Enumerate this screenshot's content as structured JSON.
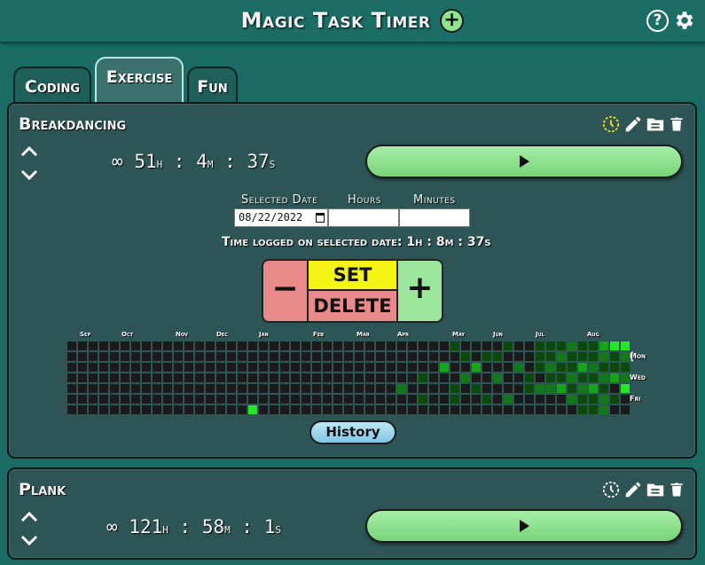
{
  "app": {
    "title": "Magic Task Timer"
  },
  "header_icons": [
    "plus-circle-icon",
    "help-icon",
    "gear-icon"
  ],
  "help_glyph": "?",
  "tabs": [
    {
      "label": "Coding",
      "active": false
    },
    {
      "label": "Exercise",
      "active": true
    },
    {
      "label": "Fun",
      "active": false
    }
  ],
  "tasks": [
    {
      "name": "Breakdancing",
      "timer": {
        "infinity": "∞",
        "hours": "51",
        "minutes": "4",
        "seconds": "37",
        "h_unit": "h",
        "m_unit": "m",
        "s_unit": "s",
        "sep": ":"
      },
      "actions": [
        "clock-icon",
        "pencil-icon",
        "folder-icon",
        "trash-icon"
      ],
      "editor": {
        "date_label": "Selected Date",
        "hours_label": "Hours",
        "minutes_label": "Minutes",
        "date_value": "08/22/2022",
        "hours_value": "",
        "minutes_value": "",
        "logged_text": "Time logged on selected date: 1h : 8m : 37s",
        "minus": "−",
        "plus": "+",
        "set": "SET",
        "delete": "DELETE"
      },
      "heatmap": {
        "months": [
          "Sep",
          "Oct",
          "Nov",
          "Dec",
          "Jan",
          "Feb",
          "Mar",
          "Apr",
          "May",
          "Jun",
          "Jul",
          "Aug"
        ],
        "days": [
          "Mon",
          "Wed",
          "Fri"
        ],
        "weeks": 53,
        "active_cells": [
          [
            17,
            6,
            4
          ],
          [
            31,
            4,
            2
          ],
          [
            33,
            3,
            1
          ],
          [
            33,
            5,
            1
          ],
          [
            35,
            2,
            3
          ],
          [
            36,
            0,
            1
          ],
          [
            36,
            4,
            1
          ],
          [
            36,
            5,
            1
          ],
          [
            37,
            1,
            1
          ],
          [
            37,
            3,
            2
          ],
          [
            38,
            2,
            3
          ],
          [
            38,
            4,
            1
          ],
          [
            39,
            1,
            1
          ],
          [
            39,
            5,
            1
          ],
          [
            40,
            1,
            1
          ],
          [
            40,
            3,
            2
          ],
          [
            41,
            0,
            1
          ],
          [
            41,
            5,
            2
          ],
          [
            42,
            2,
            2
          ],
          [
            43,
            3,
            1
          ],
          [
            43,
            4,
            1
          ],
          [
            44,
            0,
            1
          ],
          [
            44,
            1,
            1
          ],
          [
            44,
            2,
            1
          ],
          [
            44,
            4,
            2
          ],
          [
            45,
            0,
            1
          ],
          [
            45,
            1,
            1
          ],
          [
            45,
            2,
            2
          ],
          [
            45,
            3,
            1
          ],
          [
            45,
            4,
            2
          ],
          [
            46,
            0,
            1
          ],
          [
            46,
            1,
            2
          ],
          [
            46,
            2,
            1
          ],
          [
            46,
            3,
            1
          ],
          [
            46,
            4,
            3
          ],
          [
            47,
            0,
            2
          ],
          [
            47,
            1,
            1
          ],
          [
            47,
            2,
            1
          ],
          [
            47,
            3,
            2
          ],
          [
            47,
            4,
            1
          ],
          [
            47,
            5,
            2
          ],
          [
            48,
            0,
            1
          ],
          [
            48,
            1,
            1
          ],
          [
            48,
            2,
            3
          ],
          [
            48,
            3,
            1
          ],
          [
            48,
            4,
            2
          ],
          [
            48,
            5,
            1
          ],
          [
            48,
            6,
            1
          ],
          [
            49,
            0,
            1
          ],
          [
            49,
            1,
            1
          ],
          [
            49,
            2,
            2
          ],
          [
            49,
            3,
            1
          ],
          [
            49,
            4,
            3
          ],
          [
            49,
            5,
            1
          ],
          [
            49,
            6,
            1
          ],
          [
            50,
            0,
            3
          ],
          [
            50,
            1,
            2
          ],
          [
            50,
            2,
            1
          ],
          [
            50,
            3,
            2
          ],
          [
            50,
            4,
            1
          ],
          [
            50,
            5,
            2
          ],
          [
            50,
            6,
            2
          ],
          [
            51,
            0,
            4
          ],
          [
            51,
            1,
            1
          ],
          [
            51,
            2,
            1
          ],
          [
            51,
            3,
            3
          ],
          [
            51,
            5,
            1
          ],
          [
            52,
            0,
            4
          ],
          [
            52,
            1,
            2
          ],
          [
            52,
            2,
            1
          ],
          [
            52,
            3,
            2
          ],
          [
            52,
            4,
            4
          ]
        ],
        "selected_cell": [
          53,
          1
        ]
      },
      "history_label": "History"
    },
    {
      "name": "Plank",
      "timer": {
        "infinity": "∞",
        "hours": "121",
        "minutes": "58",
        "seconds": "1",
        "h_unit": "h",
        "m_unit": "m",
        "s_unit": "s",
        "sep": ":"
      },
      "actions": [
        "clock-icon",
        "pencil-icon",
        "folder-icon",
        "trash-icon"
      ]
    }
  ],
  "colors": {
    "accent_green": "#8ee58e",
    "set_yellow": "#f6f417",
    "delete_red": "#e88a8a",
    "heat_levels": [
      "#1a1a1a",
      "#0b4a0b",
      "#12781a",
      "#16a516",
      "#27e527"
    ],
    "clock_active": "#f2e21a"
  }
}
